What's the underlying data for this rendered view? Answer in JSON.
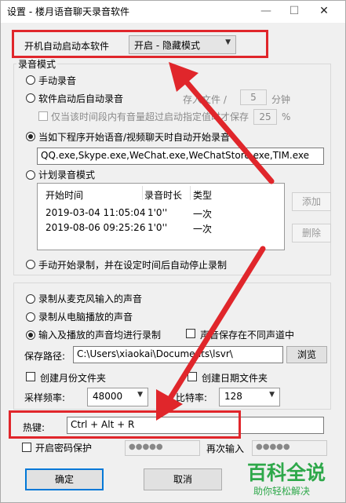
{
  "window": {
    "title": "设置 - 楼月语音聊天录音软件",
    "min": "—",
    "max": "☐",
    "close": "✕"
  },
  "autostart": {
    "label": "开机自动启动本软件",
    "value": "开启 - 隐藏模式"
  },
  "record_mode": {
    "legend": "录音模式",
    "manual": "手动录音",
    "auto_on_start": "软件启动后自动录音",
    "split_label": "存入文件 /",
    "split_value": "5",
    "split_unit": "分钟",
    "volume_check": "仅当该时间段内有音量超过启动指定值时才保存",
    "volume_value": "25",
    "volume_unit": "%",
    "on_program": "当如下程序开始语音/视频聊天时自动开始录音",
    "programs": "QQ.exe,Skype.exe,WeChat.exe,WeChatStore.exe,TIM.exe",
    "plan": "计划录音模式",
    "plan_columns": [
      "开始时间",
      "录音时长",
      "类型"
    ],
    "plan_rows": [
      {
        "start": "2019-03-04 11:05:04",
        "duration": "1'0''",
        "type": "一次"
      },
      {
        "start": "2019-08-06 09:25:26",
        "duration": "1'0''",
        "type": "一次"
      }
    ],
    "add_btn": "添加",
    "del_btn": "删除",
    "manual_timed": "手动开始录制，并在设定时间后自动停止录制"
  },
  "source": {
    "mic": "录制从麦克风输入的声音",
    "pc": "录制从电脑播放的声音",
    "both": "输入及播放的声音均进行录制",
    "separate": "声音保存在不同声道中",
    "path_label": "保存路径:",
    "path_value": "C:\\Users\\xiaokai\\Documents\\lsvr\\",
    "browse": "浏览",
    "month_folder": "创建月份文件夹",
    "date_folder": "创建日期文件夹",
    "rate_label": "采样频率:",
    "rate_value": "48000",
    "bitrate_label": "比特率:",
    "bitrate_value": "128"
  },
  "hotkey": {
    "label": "热键:",
    "value": "Ctrl + Alt + R"
  },
  "password": {
    "check": "开启密码保护",
    "value": "●●●●●",
    "again_label": "再次输入",
    "again_value": "●●●●●"
  },
  "buttons": {
    "ok": "确定",
    "cancel": "取消"
  },
  "watermark": {
    "title": "百科全说",
    "sub": "助你轻松解决"
  },
  "colors": {
    "highlight": "#e0262b",
    "accent": "#0078d7",
    "watermark": "#2ea84a"
  }
}
